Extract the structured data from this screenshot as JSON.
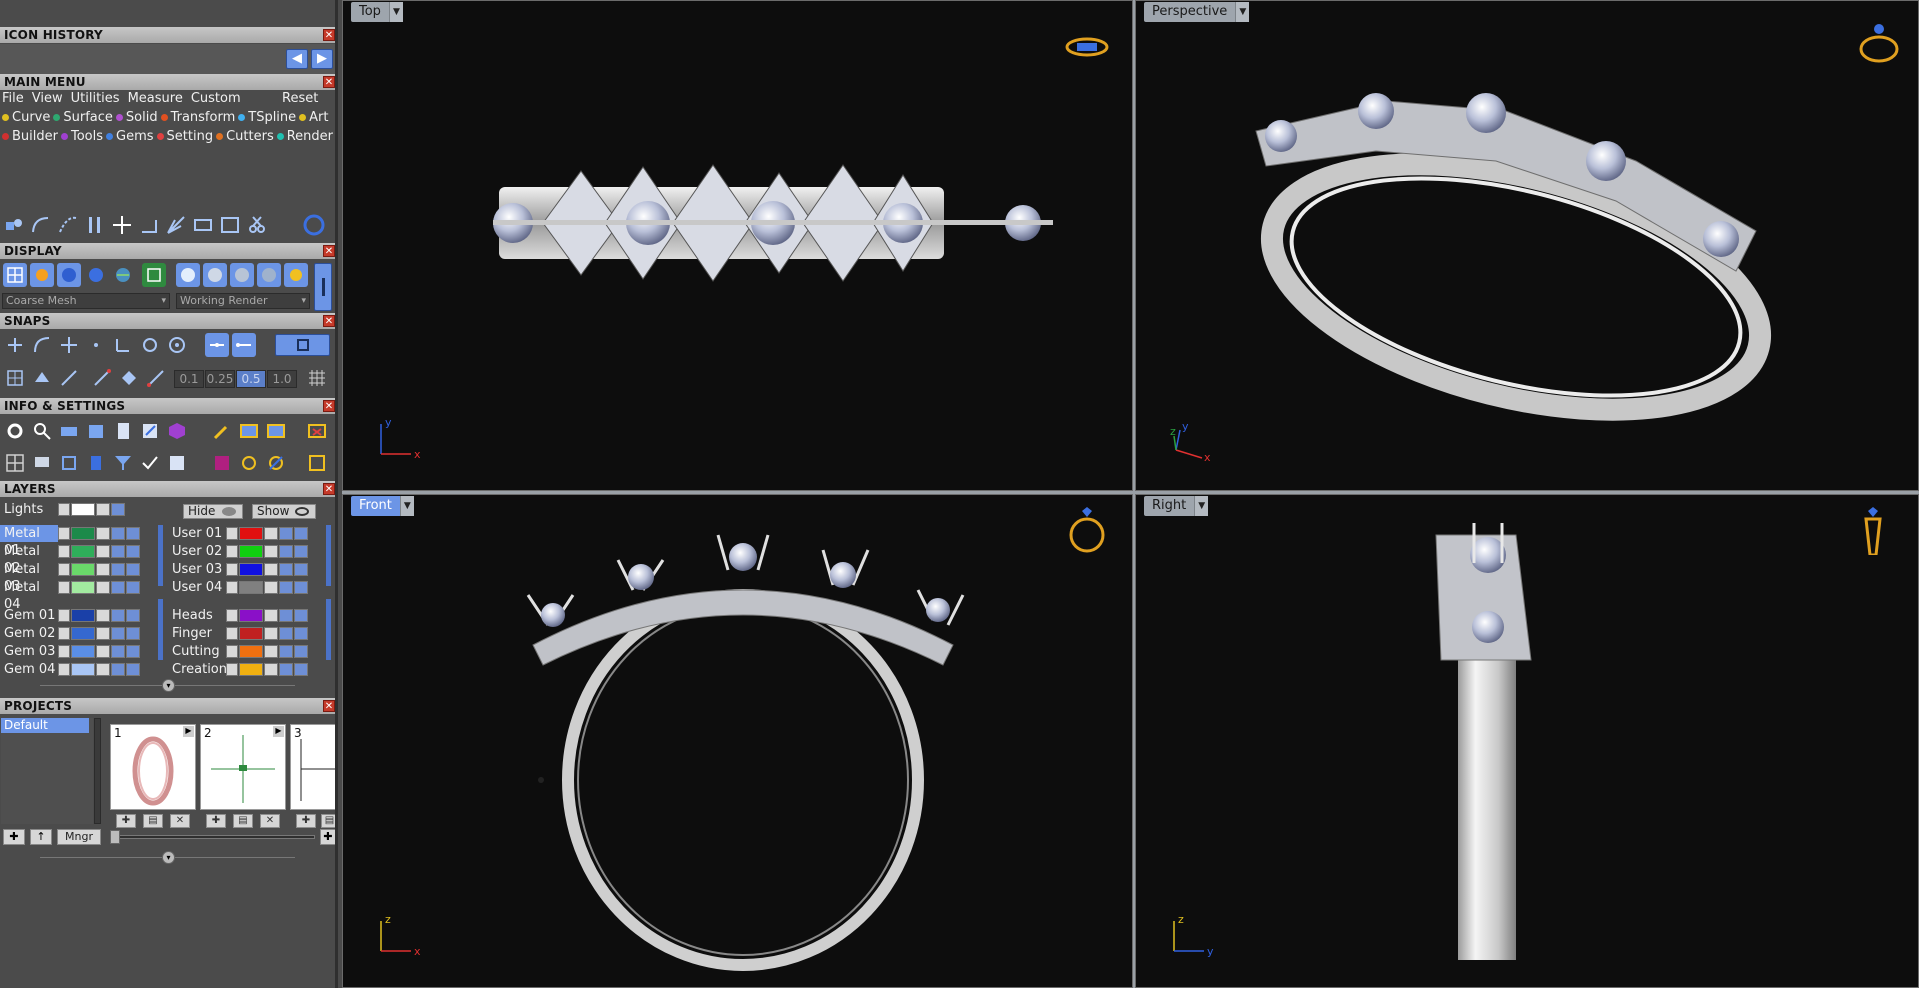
{
  "panels": {
    "icon_history": "ICON HISTORY",
    "main_menu": "MAIN MENU",
    "display": "DISPLAY",
    "snaps": "SNAPS",
    "info_settings": "INFO & SETTINGS",
    "layers": "LAYERS",
    "projects": "PROJECTS"
  },
  "main_menu": {
    "items": [
      "File",
      "View",
      "Utilities",
      "Measure",
      "Custom"
    ],
    "reset": "Reset",
    "row1": [
      {
        "label": "Curve",
        "color": "#e0c020"
      },
      {
        "label": "Surface",
        "color": "#2ea870"
      },
      {
        "label": "Solid",
        "color": "#b050d0"
      },
      {
        "label": "Transform",
        "color": "#e05020"
      },
      {
        "label": "TSpline",
        "color": "#40b0f0"
      },
      {
        "label": "Art",
        "color": "#e0c020"
      }
    ],
    "row2": [
      {
        "label": "Builder",
        "color": "#d03030"
      },
      {
        "label": "Tools",
        "color": "#a040d0"
      },
      {
        "label": "Gems",
        "color": "#4080e0"
      },
      {
        "label": "Setting",
        "color": "#e04040"
      },
      {
        "label": "Cutters",
        "color": "#e07020"
      },
      {
        "label": "Render",
        "color": "#20c0b0"
      }
    ]
  },
  "display": {
    "mesh_select": "Coarse Mesh",
    "render_select": "Working Render"
  },
  "snaps": {
    "values": [
      "0.1",
      "0.25",
      "0.5",
      "1.0"
    ],
    "active_value": "0.5"
  },
  "layers": {
    "lights": "Lights",
    "hide": "Hide",
    "show": "Show",
    "left": [
      {
        "name": "Metal 01",
        "color": "#1c8a4a",
        "selected": true
      },
      {
        "name": "Metal 02",
        "color": "#2fae5a"
      },
      {
        "name": "Metal 03",
        "color": "#6ad86a"
      },
      {
        "name": "Metal 04",
        "color": "#a2eaa0"
      },
      {
        "name": "Gem 01",
        "color": "#1a40a8"
      },
      {
        "name": "Gem 02",
        "color": "#3568d0"
      },
      {
        "name": "Gem 03",
        "color": "#5a8ee6"
      },
      {
        "name": "Gem 04",
        "color": "#a9c6f5"
      }
    ],
    "right": [
      {
        "name": "User 01",
        "color": "#e01010"
      },
      {
        "name": "User 02",
        "color": "#10d010"
      },
      {
        "name": "User 03",
        "color": "#1010e0"
      },
      {
        "name": "User 04",
        "color": "#808080"
      },
      {
        "name": "Heads",
        "color": "#8a10c8"
      },
      {
        "name": "Finger",
        "color": "#c02020"
      },
      {
        "name": "Cutting",
        "color": "#f07010"
      },
      {
        "name": "Creation",
        "color": "#f0b010"
      }
    ]
  },
  "projects": {
    "default": "Default",
    "mngr": "Mngr",
    "thumbs": [
      "1",
      "2",
      "3"
    ]
  },
  "viewports": {
    "top": {
      "label": "Top",
      "axis_v": "y",
      "axis_h": "x"
    },
    "perspective": {
      "label": "Perspective",
      "axis_v": "y",
      "axis_z": "z",
      "axis_h": "x"
    },
    "front": {
      "label": "Front",
      "axis_v": "z",
      "axis_h": "x"
    },
    "right": {
      "label": "Right",
      "axis_v": "z",
      "axis_h": "y"
    }
  }
}
